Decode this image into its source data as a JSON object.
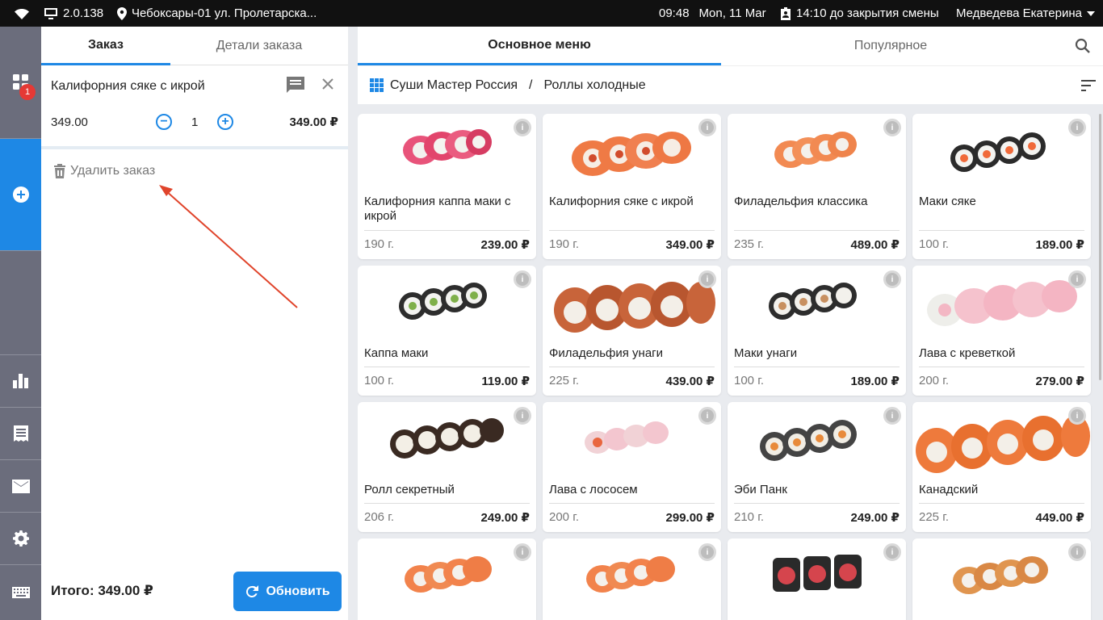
{
  "status_bar": {
    "version": "2.0.138",
    "location": "Чебоксары-01 ул. Пролетарска...",
    "time": "09:48",
    "date": "Mon, 11 Mar",
    "shift": "14:10 до закрытия смены",
    "user": "Медведева Екатерина"
  },
  "rail": {
    "badge_count": "1"
  },
  "order": {
    "tabs": [
      {
        "label": "Заказ"
      },
      {
        "label": "Детали заказа"
      }
    ],
    "item": {
      "name": "Калифорния сяке с икрой",
      "price": "349.00",
      "qty": "1",
      "total": "349.00 ₽"
    },
    "delete_label": "Удалить заказ",
    "total_label": "Итого: 349.00 ₽",
    "refresh_label": "Обновить"
  },
  "menu": {
    "tabs": [
      {
        "label": "Основное меню"
      },
      {
        "label": "Популярное"
      }
    ],
    "breadcrumb": {
      "root": "Суши Мастер Россия",
      "sep": "/",
      "current": "Роллы холодные"
    },
    "products": [
      {
        "name": "Калифорния каппа маки с икрой",
        "weight": "190 г.",
        "price": "239.00 ₽"
      },
      {
        "name": "Калифорния сяке с икрой",
        "weight": "190 г.",
        "price": "349.00 ₽"
      },
      {
        "name": "Филадельфия классика",
        "weight": "235 г.",
        "price": "489.00 ₽"
      },
      {
        "name": "Маки сяке",
        "weight": "100 г.",
        "price": "189.00 ₽"
      },
      {
        "name": "Каппа маки",
        "weight": "100 г.",
        "price": "119.00 ₽"
      },
      {
        "name": "Филадельфия унаги",
        "weight": "225 г.",
        "price": "439.00 ₽"
      },
      {
        "name": "Маки унаги",
        "weight": "100 г.",
        "price": "189.00 ₽"
      },
      {
        "name": "Лава с креветкой",
        "weight": "200 г.",
        "price": "279.00 ₽"
      },
      {
        "name": "Ролл секретный",
        "weight": "206 г.",
        "price": "249.00 ₽"
      },
      {
        "name": "Лава с лососем",
        "weight": "200 г.",
        "price": "299.00 ₽"
      },
      {
        "name": "Эби Панк",
        "weight": "210 г.",
        "price": "249.00 ₽"
      },
      {
        "name": "Канадский",
        "weight": "225 г.",
        "price": "449.00 ₽"
      }
    ]
  },
  "colors": {
    "accent": "#1e88e5",
    "rail": "#6b6d7c",
    "badge": "#e53935",
    "annotation_arrow": "#e0442b"
  },
  "icons": [
    "wifi-icon",
    "monitor-icon",
    "location-pin-icon",
    "badge-icon",
    "dropdown-caret-icon",
    "grid-apps-icon",
    "add-circle-icon",
    "bar-chart-icon",
    "receipt-icon",
    "mail-icon",
    "gear-icon",
    "keyboard-icon",
    "comment-icon",
    "close-icon",
    "minus-circle-icon",
    "plus-circle-icon",
    "trash-icon",
    "refresh-icon",
    "search-icon",
    "grid-icon",
    "sort-icon",
    "info-icon"
  ]
}
